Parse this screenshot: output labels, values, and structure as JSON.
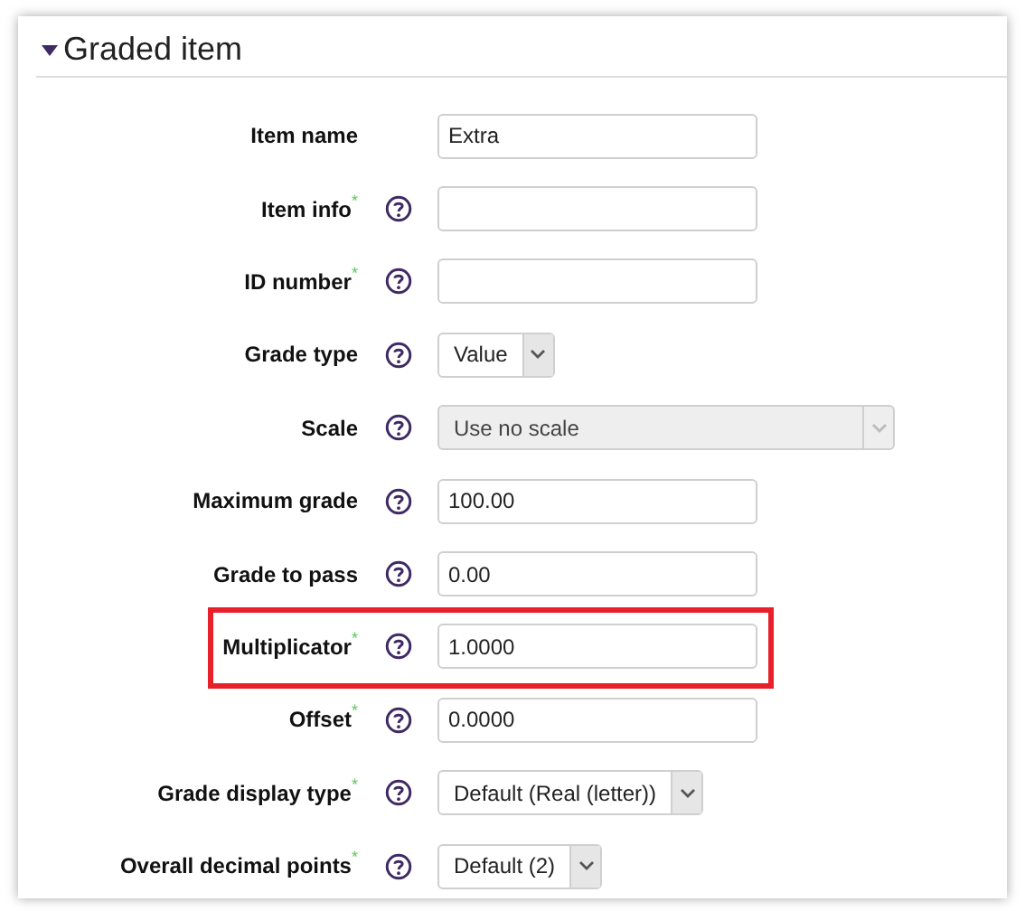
{
  "section": {
    "title": "Graded item",
    "expanded": true
  },
  "fields": [
    {
      "label": "Item name",
      "help": false,
      "kind": "text",
      "value": "Extra",
      "highlighted": false
    },
    {
      "label": "Item info",
      "marker": "*",
      "help": true,
      "kind": "text",
      "highlighted": false
    },
    {
      "label": "ID number",
      "marker": "*",
      "help": true,
      "kind": "text",
      "highlighted": false
    },
    {
      "label": "Grade type",
      "help": true,
      "kind": "select",
      "value": "Value",
      "disabled": false,
      "highlighted": false
    },
    {
      "label": "Scale",
      "help": true,
      "kind": "select",
      "value": "Use no scale",
      "disabled": true,
      "highlighted": false
    },
    {
      "label": "Maximum grade",
      "help": true,
      "kind": "text",
      "value": "100.00",
      "highlighted": false
    },
    {
      "label": "Grade to pass",
      "help": true,
      "kind": "text",
      "value": "0.00",
      "highlighted": false
    },
    {
      "label": "Multiplicator",
      "marker": "*",
      "help": true,
      "kind": "text",
      "value": "1.0000",
      "highlighted": true
    },
    {
      "label": "Offset",
      "marker": "*",
      "help": true,
      "kind": "text",
      "value": "0.0000",
      "highlighted": false
    },
    {
      "label": "Grade display type",
      "marker": "*",
      "help": true,
      "kind": "select",
      "value": "Default (Real (letter))",
      "disabled": false,
      "highlighted": false
    },
    {
      "label": "Overall decimal points",
      "marker": "*",
      "help": true,
      "kind": "select",
      "value": "Default (2)",
      "disabled": false,
      "highlighted": false
    }
  ]
}
